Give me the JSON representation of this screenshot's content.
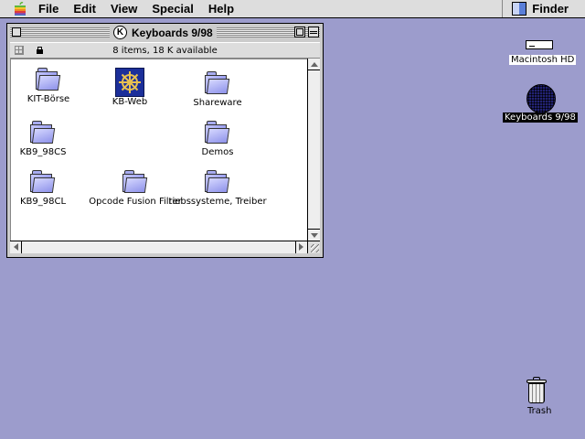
{
  "menubar": {
    "items": [
      "File",
      "Edit",
      "View",
      "Special",
      "Help"
    ],
    "app_name": "Finder"
  },
  "window": {
    "title": "Keyboards 9/98",
    "status": "8 items, 18 K available",
    "items": [
      {
        "label": "KIT-Börse",
        "icon": "folder-icon"
      },
      {
        "label": "KB-Web",
        "icon": "kb-web-app-icon"
      },
      {
        "label": "Shareware",
        "icon": "folder-icon"
      },
      {
        "label": "KB9_98CS",
        "icon": "folder-icon"
      },
      {
        "label": "Demos",
        "icon": "folder-icon"
      },
      {
        "label": "KB9_98CL",
        "icon": "folder-icon"
      },
      {
        "label": "Opcode Fusion Filter",
        "icon": "folder-icon"
      },
      {
        "label": "riebssysteme, Treiber",
        "icon": "folder-icon"
      }
    ]
  },
  "desktop": {
    "hard_drive": "Macintosh HD",
    "selected_disk": "Keyboards 9/98",
    "trash": "Trash"
  },
  "colors": {
    "desktop_bg": "#9c9ccc",
    "folder": "#9a9ef0",
    "kb_web_icon": "#1c2f9a"
  }
}
